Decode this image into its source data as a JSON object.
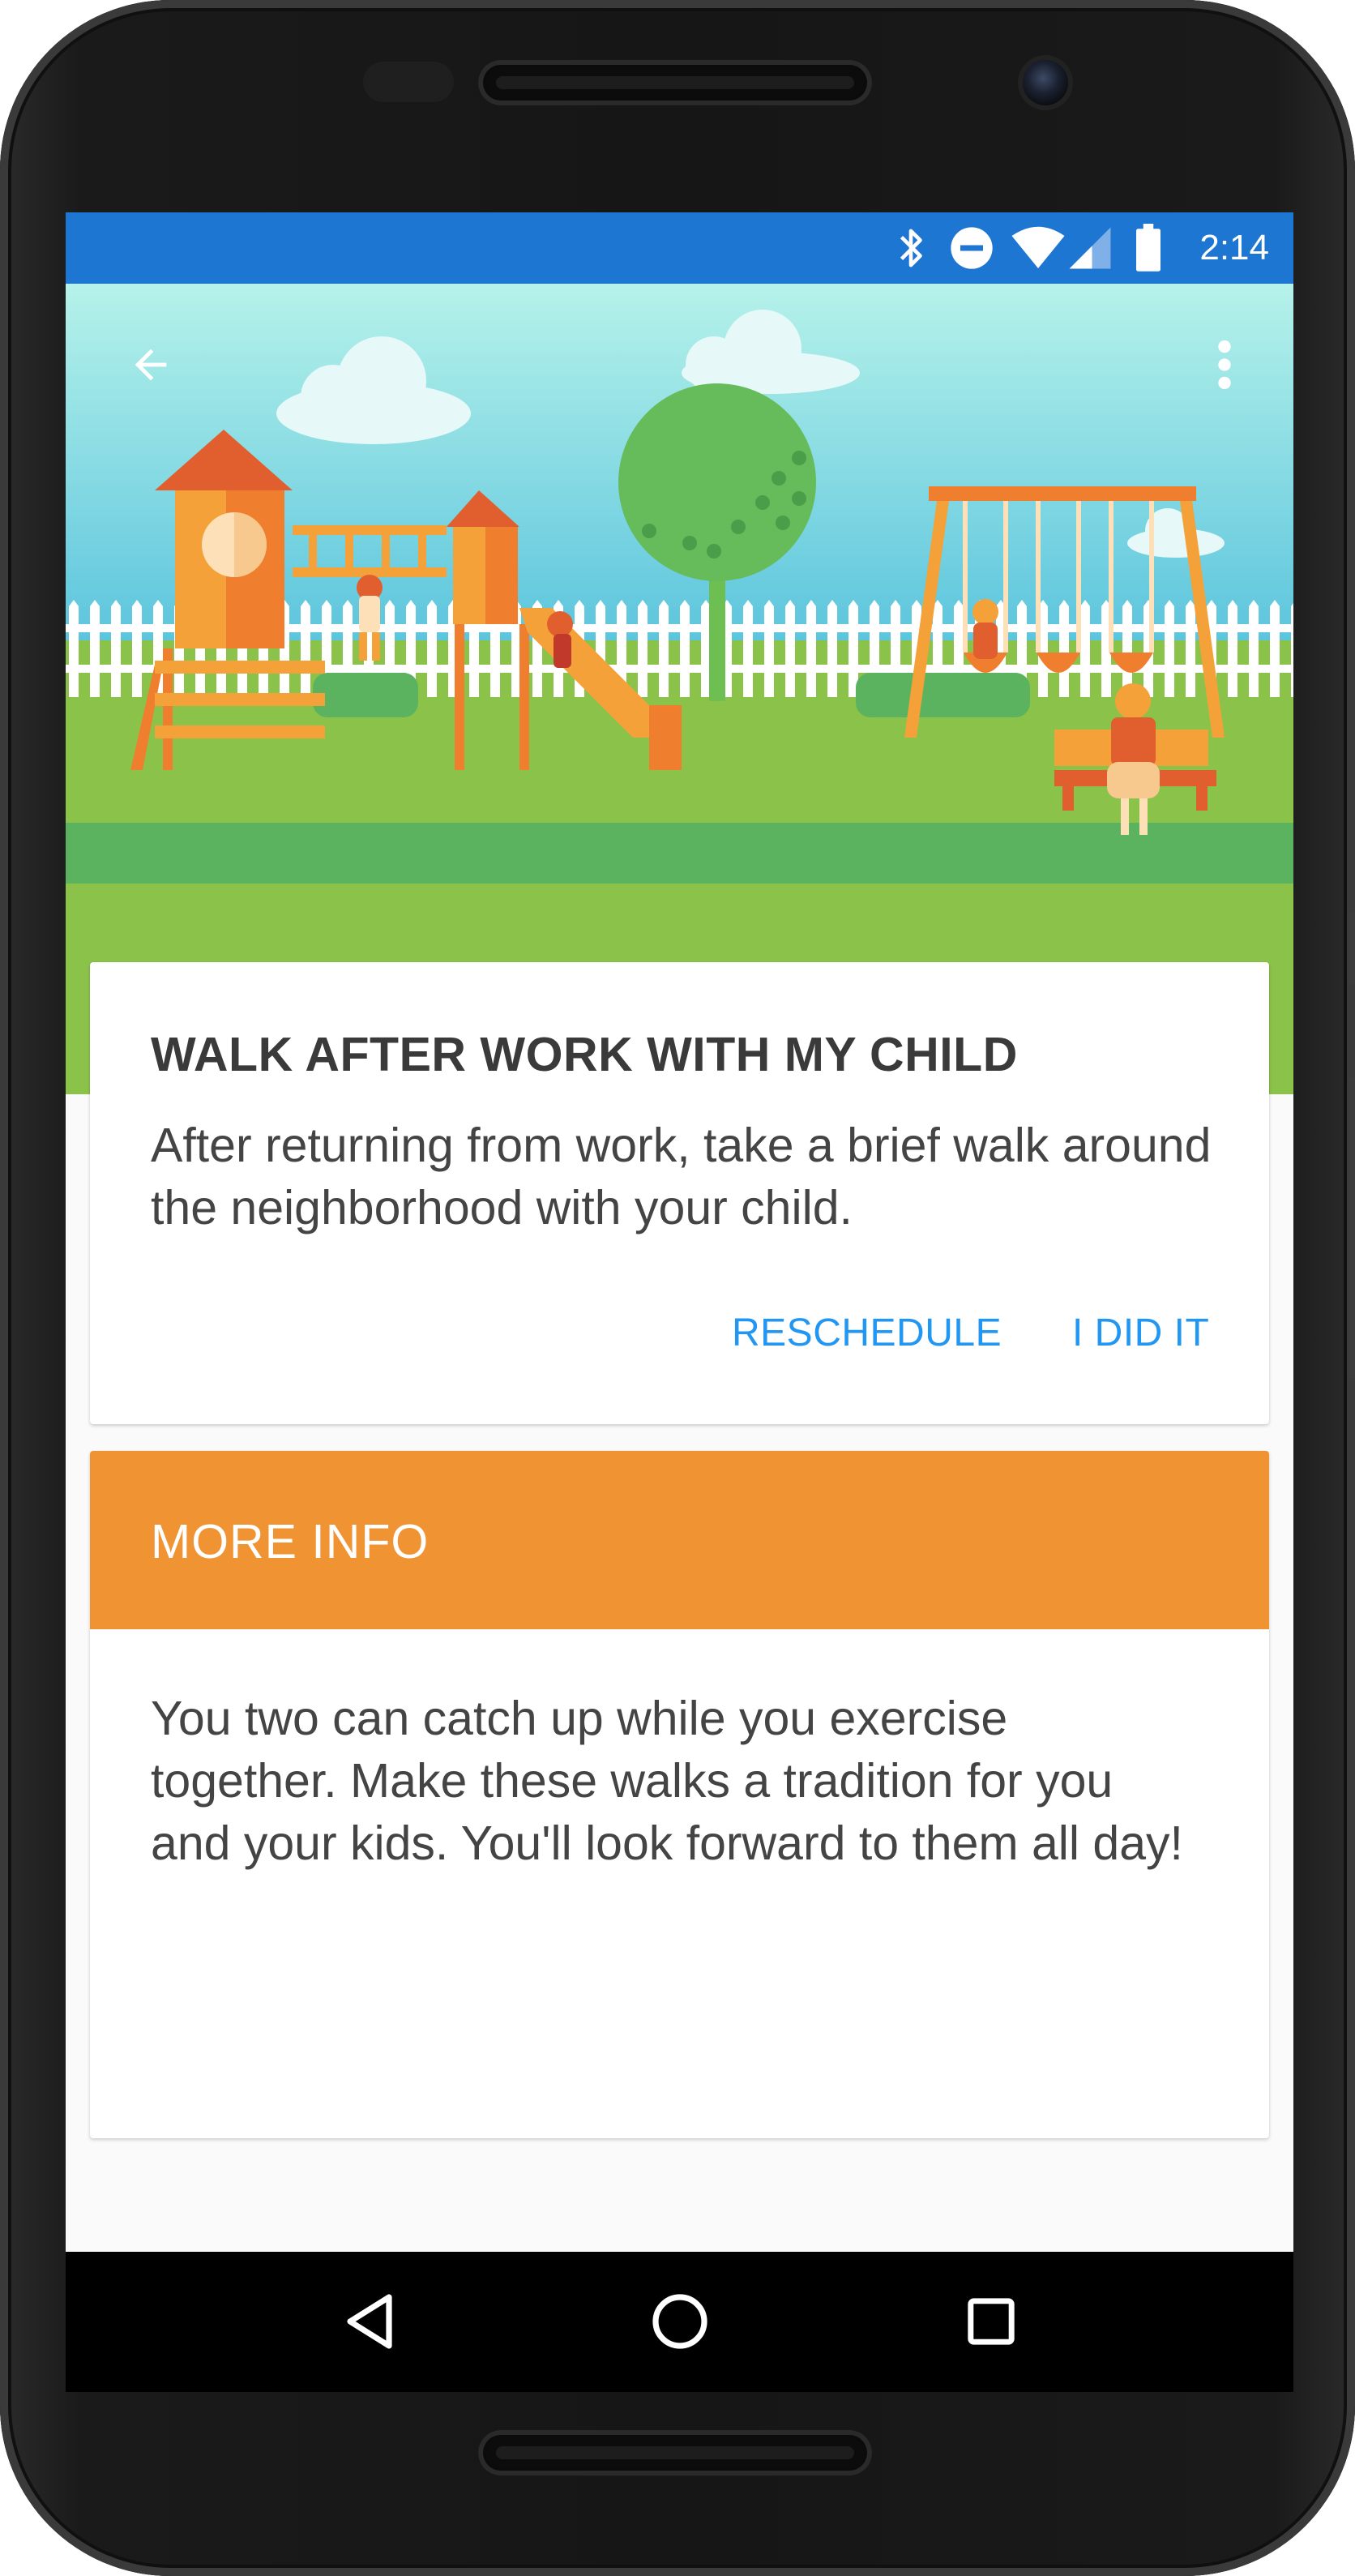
{
  "status_bar": {
    "time": "2:14",
    "icons": [
      "bluetooth-icon",
      "do-not-disturb-icon",
      "wifi-icon",
      "cell-signal-icon",
      "battery-icon"
    ],
    "color": "#1e76d3"
  },
  "toolbar": {
    "back_icon": "arrow-back-icon",
    "menu_icon": "more-vert-icon"
  },
  "activity_card": {
    "title": "WALK AFTER WORK WITH MY CHILD",
    "description": "After returning from work, take a brief walk around the neighborhood with your child.",
    "actions": [
      "RESCHEDULE",
      "I DID IT"
    ],
    "action_color": "#2196f3"
  },
  "info_card": {
    "header": "MORE INFO",
    "header_color": "#f09433",
    "body": "You two can catch up while you exercise together. Make these walks a tradition for you and your kids. You'll look forward to them all day!"
  },
  "nav_bar": {
    "buttons": [
      "back-triangle-icon",
      "home-circle-icon",
      "recents-square-icon"
    ]
  }
}
